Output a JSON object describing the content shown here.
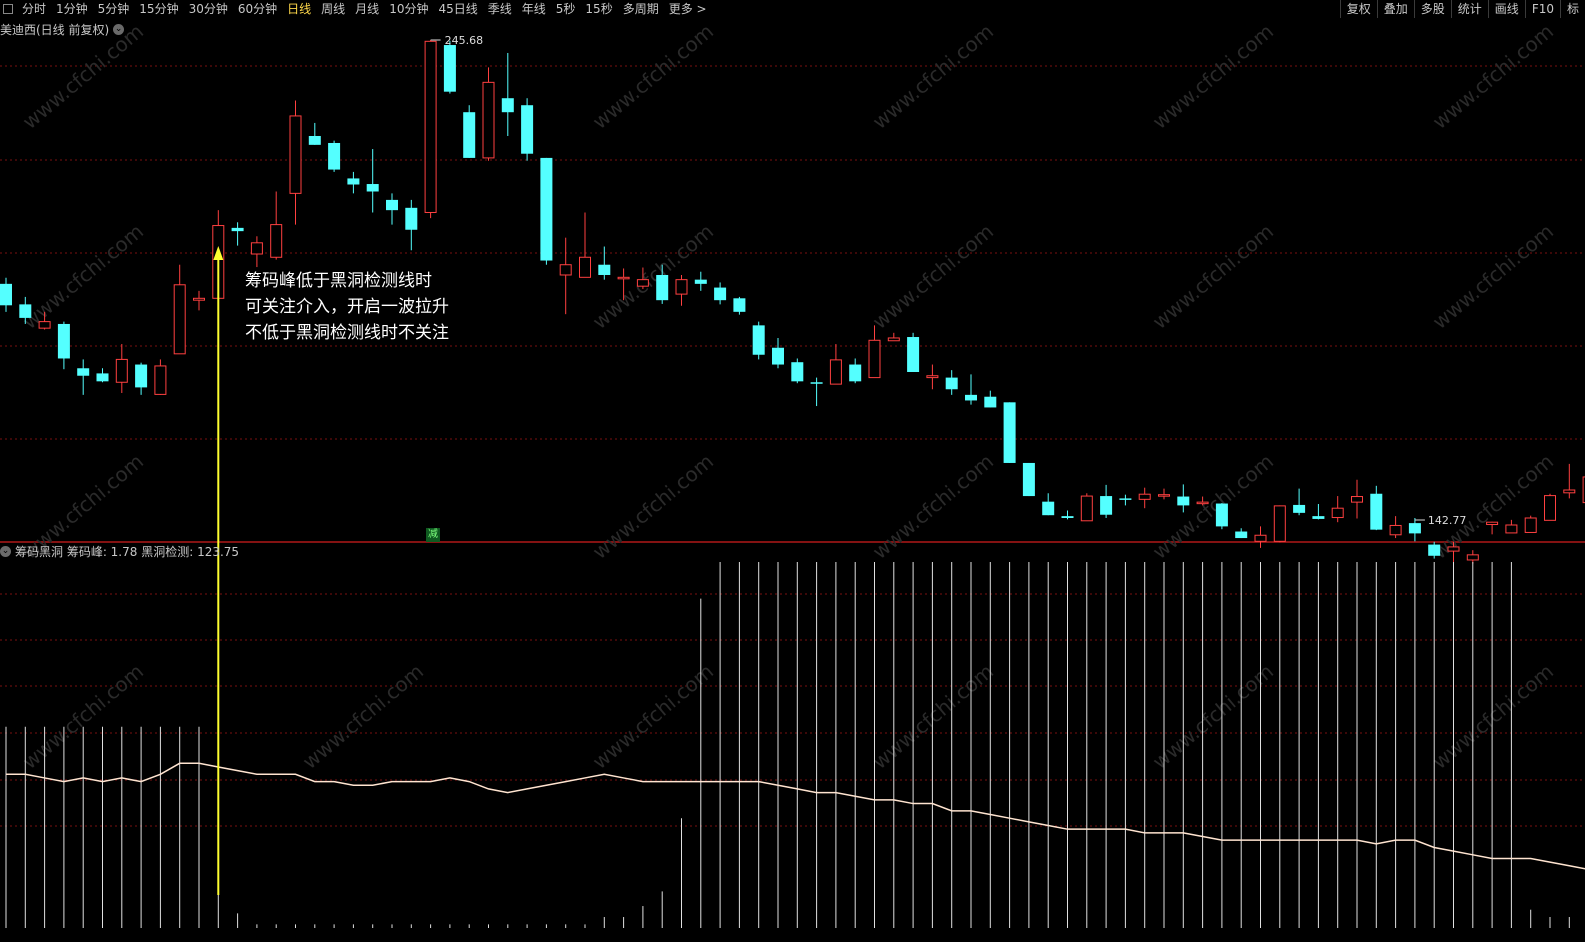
{
  "toolbar": {
    "periods": [
      "分时",
      "1分钟",
      "5分钟",
      "15分钟",
      "30分钟",
      "60分钟",
      "日线",
      "周线",
      "月线",
      "10分钟",
      "45日线",
      "季线",
      "年线",
      "5秒",
      "15秒",
      "多周期",
      "更多 >"
    ],
    "active_period": "日线",
    "right": [
      "复权",
      "叠加",
      "多股",
      "统计",
      "画线",
      "F10",
      "标"
    ]
  },
  "stock": {
    "title": "美迪西(日线 前复权)"
  },
  "indicator": {
    "title": "筹码黑洞 筹码峰: 1.78 黑洞检测: 123.75"
  },
  "annotation": {
    "line1": "筹码峰低于黑洞检测线时",
    "line2": "可关注介入，开启一波拉升",
    "line3": "不低于黑洞检测线时不关注"
  },
  "badge": "减",
  "watermark": "www.cfchi.com",
  "colors": {
    "up": "#ff4040",
    "down": "#54ffff",
    "grid": "#7a1010",
    "arrow": "#ffff30",
    "line": "#ffe4d0",
    "bars": "#e0e0e0"
  },
  "chart_data": [
    {
      "type": "candlestick",
      "price_range": [
        142.77,
        245.68
      ],
      "labels": {
        "high": "245.68",
        "low": "142.77"
      },
      "candles": [
        [
          193.4,
          188.8,
          194.7,
          187.4
        ],
        [
          189.0,
          186.1,
          190.6,
          184.8
        ],
        [
          183.9,
          185.3,
          187.4,
          183.6
        ],
        [
          184.8,
          177.4,
          185.3,
          175.1
        ],
        [
          175.3,
          173.7,
          177.2,
          169.6
        ],
        [
          174.2,
          172.5,
          175.3,
          172.3
        ],
        [
          172.3,
          177.2,
          180.5,
          170.0
        ],
        [
          176.1,
          171.2,
          176.5,
          169.6
        ],
        [
          169.7,
          175.8,
          177.2,
          169.6
        ],
        [
          178.4,
          193.2,
          197.5,
          178.4
        ],
        [
          189.9,
          190.3,
          191.9,
          187.7
        ],
        [
          190.3,
          205.9,
          209.2,
          190.3
        ],
        [
          205.4,
          204.7,
          206.6,
          201.6
        ],
        [
          199.8,
          202.2,
          203.6,
          197.0
        ],
        [
          199.1,
          206.1,
          213.2,
          198.6
        ],
        [
          212.8,
          229.4,
          232.7,
          206.1
        ],
        [
          225.1,
          223.2,
          227.9,
          223.2
        ],
        [
          223.6,
          217.9,
          224.1,
          217.4
        ],
        [
          216.0,
          214.7,
          217.4,
          212.8
        ],
        [
          214.8,
          213.2,
          222.3,
          208.7
        ],
        [
          211.4,
          209.2,
          212.8,
          206.1
        ],
        [
          209.7,
          205.0,
          211.4,
          200.6
        ],
        [
          208.7,
          245.4,
          245.68,
          207.5
        ],
        [
          244.6,
          234.6,
          245.5,
          234.2
        ],
        [
          230.2,
          220.4,
          231.7,
          220.4
        ],
        [
          220.4,
          236.6,
          239.8,
          219.8
        ],
        [
          233.2,
          230.2,
          242.9,
          225.1
        ],
        [
          231.7,
          221.3,
          233.2,
          219.8
        ],
        [
          220.4,
          198.4,
          220.4,
          197.5
        ],
        [
          195.3,
          197.5,
          203.3,
          186.9
        ],
        [
          194.8,
          199.1,
          208.7,
          194.8
        ],
        [
          197.5,
          195.3,
          201.4,
          194.3
        ],
        [
          194.8,
          194.8,
          196.7,
          189.9
        ],
        [
          192.9,
          194.3,
          196.9,
          192.3
        ],
        [
          195.3,
          189.9,
          197.5,
          189.1
        ],
        [
          191.2,
          194.3,
          195.3,
          188.7
        ],
        [
          194.3,
          193.4,
          196.0,
          191.9
        ],
        [
          192.6,
          189.9,
          193.7,
          189.0
        ],
        [
          190.3,
          187.4,
          190.6,
          186.8
        ],
        [
          184.5,
          178.2,
          185.3,
          177.2
        ],
        [
          179.7,
          176.1,
          181.8,
          175.3
        ],
        [
          176.6,
          172.5,
          177.4,
          172.1
        ],
        [
          172.3,
          172.0,
          173.3,
          167.2
        ],
        [
          171.9,
          177.1,
          180.5,
          171.9
        ],
        [
          176.1,
          172.5,
          177.4,
          172.1
        ],
        [
          173.3,
          181.3,
          184.5,
          173.3
        ],
        [
          181.2,
          181.8,
          182.9,
          181.2
        ],
        [
          182.0,
          174.5,
          182.9,
          174.5
        ],
        [
          173.3,
          173.7,
          176.1,
          170.8
        ],
        [
          173.3,
          170.8,
          174.9,
          169.6
        ],
        [
          169.6,
          168.4,
          174.0,
          167.5
        ],
        [
          169.2,
          166.9,
          170.5,
          166.9
        ],
        [
          168.0,
          155.0,
          168.0,
          155.0
        ],
        [
          155.0,
          147.9,
          155.0,
          147.9
        ],
        [
          146.7,
          143.8,
          148.5,
          143.8
        ],
        [
          143.6,
          143.2,
          144.8,
          142.9
        ],
        [
          142.6,
          147.9,
          148.5,
          142.6
        ],
        [
          147.9,
          143.9,
          150.3,
          143.2
        ],
        [
          147.4,
          147.2,
          148.2,
          145.9
        ],
        [
          147.2,
          148.3,
          149.7,
          145.3
        ],
        [
          148.0,
          148.2,
          149.5,
          147.2
        ],
        [
          147.8,
          145.9,
          150.4,
          144.4
        ],
        [
          146.5,
          146.6,
          147.8,
          145.9
        ],
        [
          146.3,
          141.4,
          146.4,
          140.8
        ],
        [
          140.3,
          138.9,
          141.0,
          138.9
        ],
        [
          138.2,
          139.5,
          141.4,
          136.8
        ],
        [
          138.2,
          145.8,
          145.9,
          138.0
        ],
        [
          146.0,
          144.3,
          149.5,
          143.8
        ],
        [
          143.6,
          143.0,
          146.2,
          142.9
        ],
        [
          143.3,
          145.3,
          147.9,
          142.3
        ],
        [
          146.6,
          147.8,
          151.4,
          143.1
        ],
        [
          148.4,
          140.7,
          150.1,
          140.6
        ],
        [
          139.6,
          141.6,
          143.6,
          138.9
        ],
        [
          142.1,
          139.9,
          143.2,
          138.2
        ],
        [
          137.5,
          135.1,
          138.1,
          134.5
        ],
        [
          136.1,
          137.0,
          138.1,
          130.9
        ],
        [
          134.2,
          135.3,
          136.3,
          133.4
        ],
        [
          141.8,
          142.3,
          142.4,
          139.7
        ],
        [
          140.0,
          141.7,
          142.8,
          141.2
        ],
        [
          140.1,
          143.2,
          143.7,
          140.4
        ],
        [
          142.7,
          148.0,
          148.4,
          142.7
        ],
        [
          148.6,
          149.2,
          154.8,
          147.4
        ],
        [
          146.5,
          152.0,
          154.2,
          144.9
        ],
        [
          149.7,
          153.2,
          156.3,
          148.3
        ],
        [
          153.1,
          166.5,
          167.6,
          152.0
        ]
      ]
    },
    {
      "type": "bar+line",
      "series": [
        {
          "name": "筹码峰",
          "last": 1.78
        },
        {
          "name": "黑洞检测",
          "last": 123.75
        }
      ],
      "bars": [
        0.55,
        0.55,
        0.55,
        0.55,
        0.55,
        0.55,
        0.55,
        0.55,
        0.55,
        0.55,
        0.55,
        0.55,
        0.04,
        0.01,
        0.01,
        0.01,
        0.01,
        0.01,
        0.01,
        0.01,
        0.01,
        0.01,
        0.01,
        0.01,
        0.01,
        0.01,
        0.01,
        0.01,
        0.01,
        0.01,
        0.01,
        0.03,
        0.03,
        0.06,
        0.1,
        0.3,
        0.9,
        1.0,
        1.0,
        1.0,
        1.0,
        1.0,
        1.0,
        1.0,
        1.0,
        1.0,
        1.0,
        1.0,
        1.0,
        1.0,
        1.0,
        1.0,
        1.0,
        1.0,
        1.0,
        1.0,
        1.0,
        1.0,
        1.0,
        1.0,
        1.0,
        1.0,
        1.0,
        1.0,
        1.0,
        1.0,
        1.0,
        1.0,
        1.0,
        1.0,
        1.0,
        1.0,
        1.0,
        1.0,
        1.0,
        1.0,
        1.0,
        1.0,
        1.0,
        0.05,
        0.03,
        0.03,
        0.03,
        0.03,
        0.03
      ],
      "line": [
        0.42,
        0.42,
        0.41,
        0.4,
        0.41,
        0.4,
        0.41,
        0.4,
        0.42,
        0.45,
        0.45,
        0.44,
        0.43,
        0.42,
        0.42,
        0.42,
        0.4,
        0.4,
        0.39,
        0.39,
        0.4,
        0.4,
        0.4,
        0.41,
        0.4,
        0.38,
        0.37,
        0.38,
        0.39,
        0.4,
        0.41,
        0.42,
        0.41,
        0.4,
        0.4,
        0.4,
        0.4,
        0.4,
        0.4,
        0.4,
        0.39,
        0.38,
        0.37,
        0.37,
        0.36,
        0.35,
        0.35,
        0.34,
        0.34,
        0.32,
        0.32,
        0.31,
        0.3,
        0.29,
        0.28,
        0.27,
        0.27,
        0.27,
        0.27,
        0.26,
        0.26,
        0.26,
        0.25,
        0.24,
        0.24,
        0.24,
        0.24,
        0.24,
        0.24,
        0.24,
        0.24,
        0.23,
        0.24,
        0.24,
        0.22,
        0.21,
        0.2,
        0.19,
        0.19,
        0.19,
        0.18,
        0.17,
        0.16,
        0.14,
        0.1
      ]
    }
  ]
}
